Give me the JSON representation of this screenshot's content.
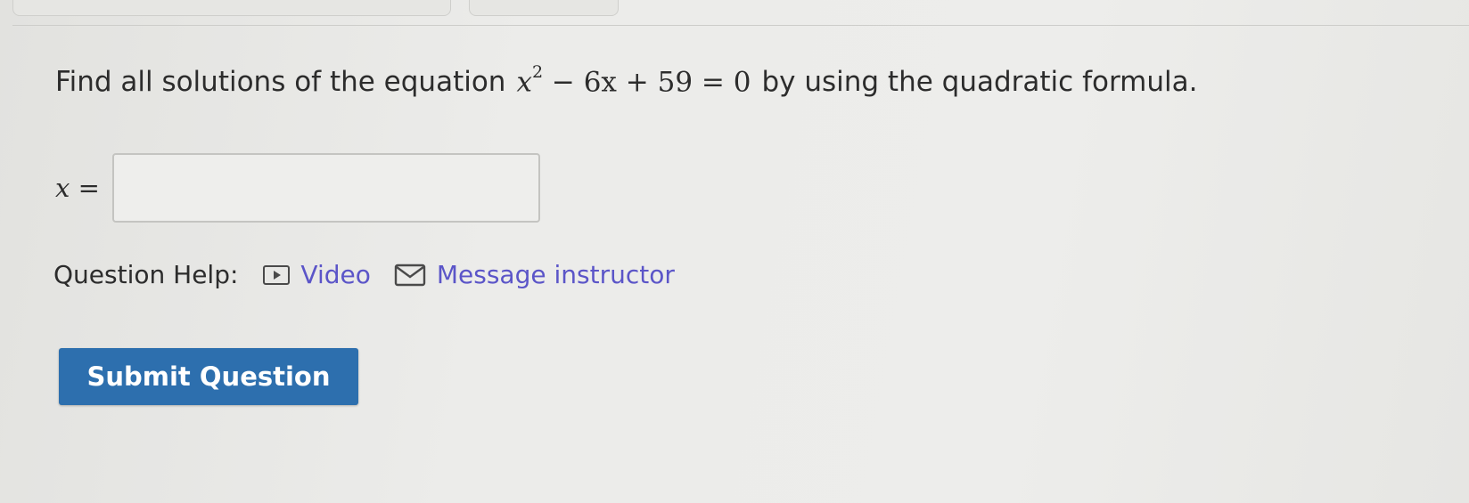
{
  "question": {
    "prefix": "Find all solutions of the equation",
    "equation": {
      "base": "x",
      "exponent": "2",
      "rest": " − 6x + 59 = 0"
    },
    "suffix": "by using the quadratic formula."
  },
  "answer": {
    "label": "x =",
    "value": ""
  },
  "help": {
    "label": "Question Help:",
    "video_label": "Video",
    "message_label": "Message instructor"
  },
  "submit_label": "Submit Question",
  "colors": {
    "link": "#5b55c8",
    "submit_bg": "#2d6fae",
    "submit_text": "#ffffff"
  },
  "icons": {
    "video": "video-icon",
    "message": "mail-icon"
  }
}
